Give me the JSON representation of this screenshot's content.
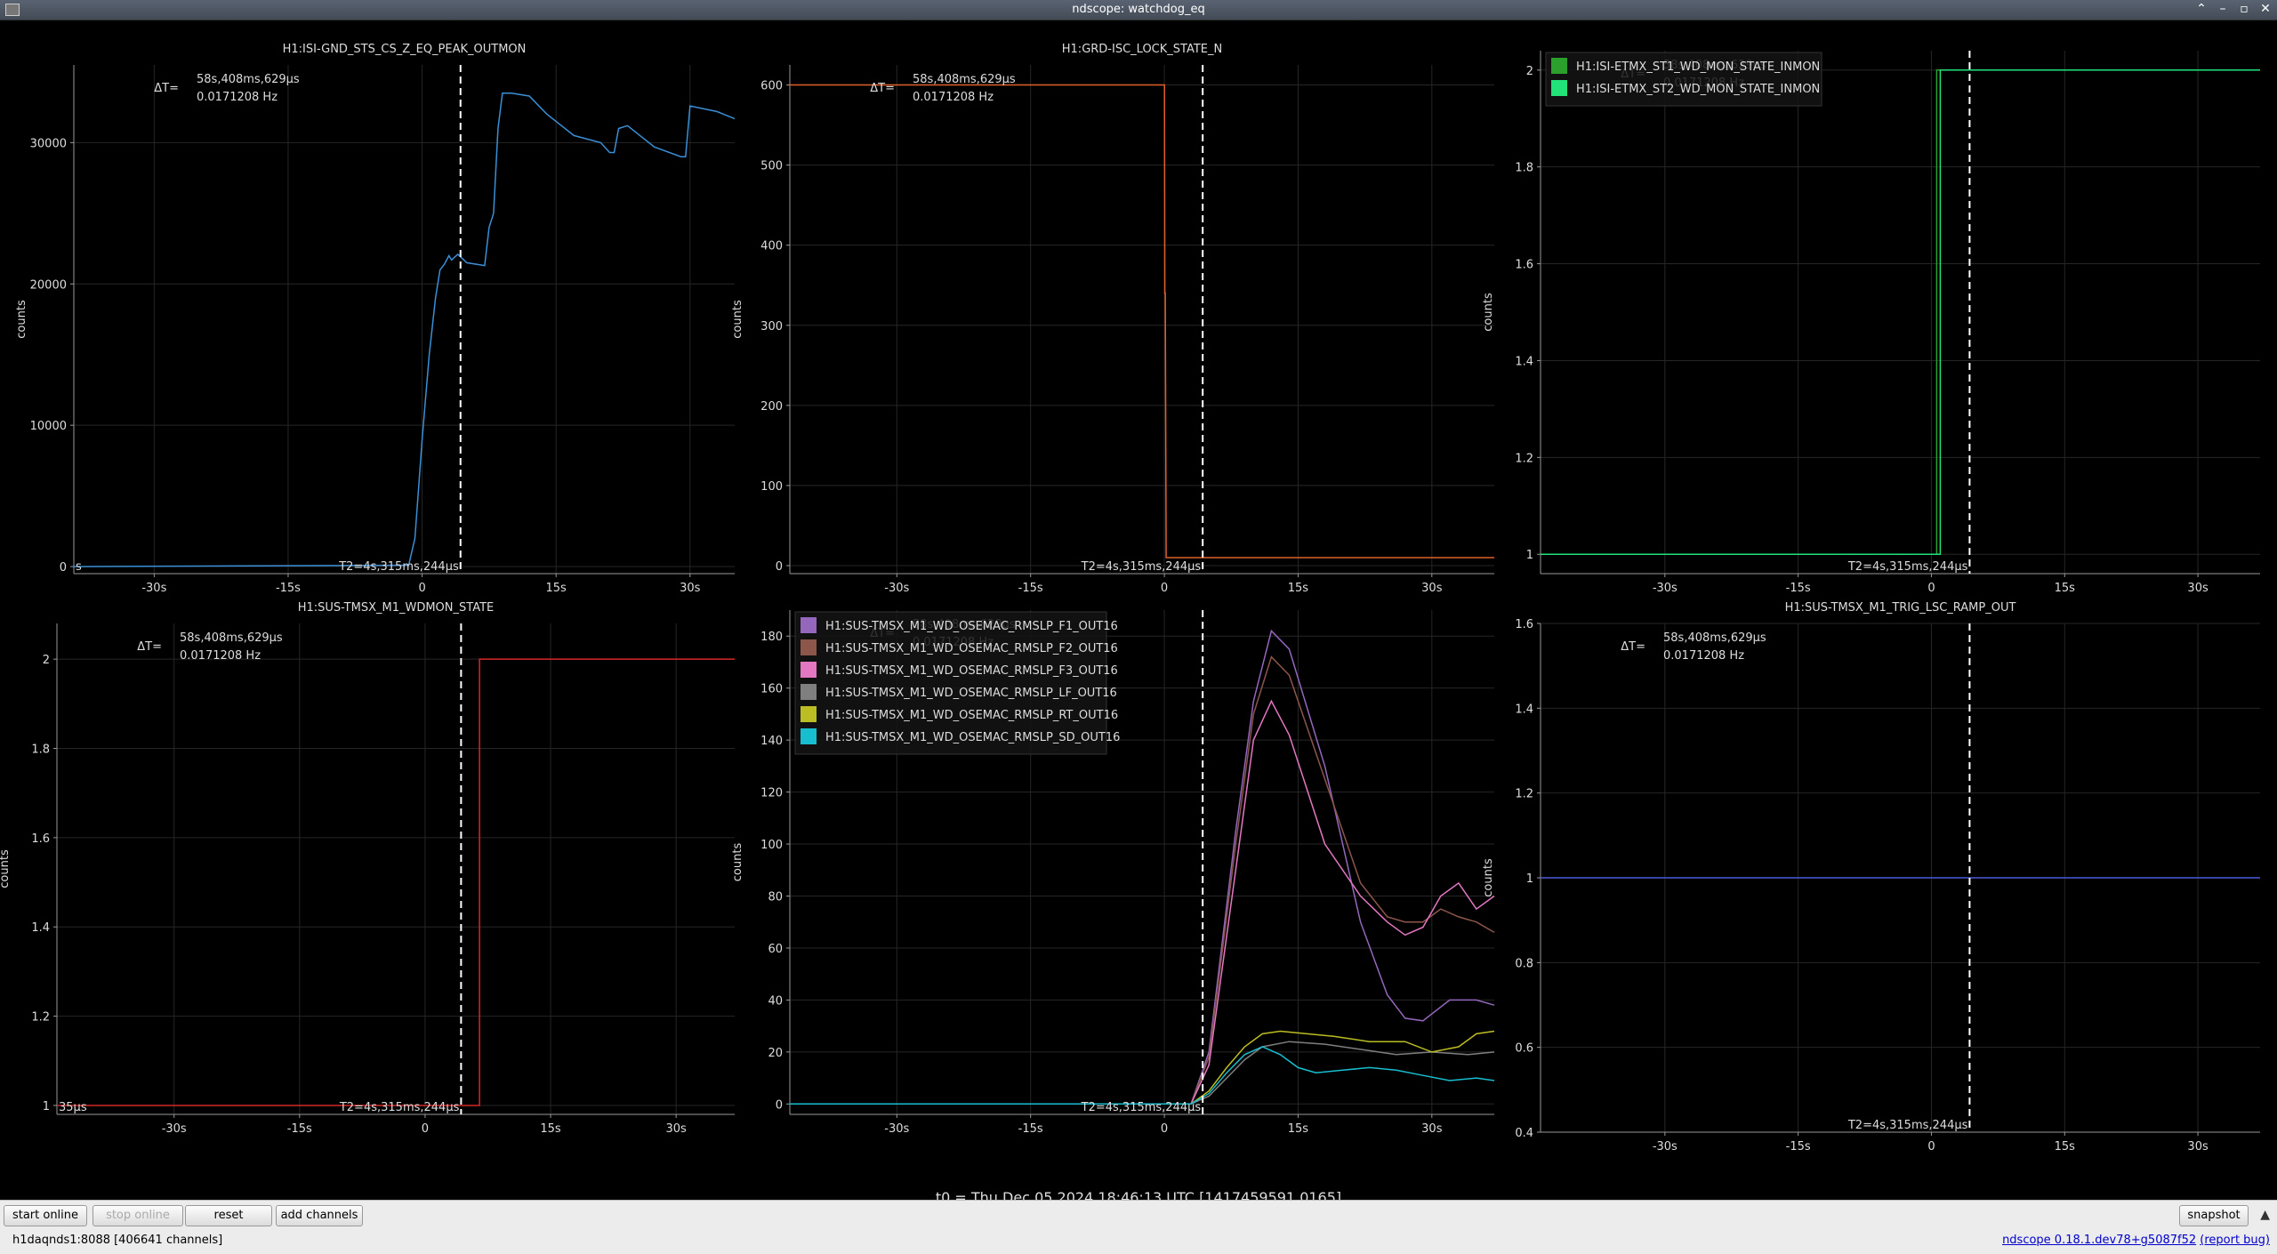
{
  "window": {
    "title": "ndscope: watchdog_eq",
    "controls": [
      "⌃",
      "–",
      "▫",
      "✕"
    ]
  },
  "cursors": {
    "delta_t": "ΔT=",
    "delta_t_value": "58s,408ms,629μs",
    "delta_t_freq": "0.0171208 Hz",
    "t2_label": "T2=4s,315ms,244μs"
  },
  "plots": [
    {
      "title": "H1:ISI-GND_STS_CS_Z_EQ_PEAK_OUTMON",
      "ylabel": "counts",
      "yticks": [
        "0",
        "10000",
        "20000",
        "30000"
      ],
      "xticks": [
        "-30s",
        "-15s",
        "0",
        "15s",
        "30s"
      ],
      "t1_label_fragment": "s",
      "series": [
        {
          "name": "H1:ISI-GND_STS_CS_Z_EQ_PEAK_OUTMON",
          "color": "#3a8fd6"
        }
      ]
    },
    {
      "title": "H1:GRD-ISC_LOCK_STATE_N",
      "ylabel": "counts",
      "yticks": [
        "0",
        "100",
        "200",
        "300",
        "400",
        "500",
        "600"
      ],
      "xticks": [
        "-30s",
        "-15s",
        "0",
        "15s",
        "30s"
      ],
      "series": [
        {
          "name": "H1:GRD-ISC_LOCK_STATE_N",
          "color": "#e0602c"
        }
      ]
    },
    {
      "title": "",
      "ylabel": "counts",
      "yticks": [
        "1",
        "1.2",
        "1.4",
        "1.6",
        "1.8",
        "2"
      ],
      "xticks": [
        "-30s",
        "-15s",
        "0",
        "15s",
        "30s"
      ],
      "legend": [
        {
          "name": "H1:ISI-ETMX_ST1_WD_MON_STATE_INMON",
          "color": "#2ca02c"
        },
        {
          "name": "H1:ISI-ETMX_ST2_WD_MON_STATE_INMON",
          "color": "#22e37a"
        }
      ]
    },
    {
      "title": "H1:SUS-TMSX_M1_WDMON_STATE",
      "ylabel": "counts",
      "yticks": [
        "1",
        "1.2",
        "1.4",
        "1.6",
        "1.8",
        "2"
      ],
      "xticks": [
        "-30s",
        "-15s",
        "0",
        "15s",
        "30s"
      ],
      "t1_label_fragment": "35μs",
      "series": [
        {
          "name": "H1:SUS-TMSX_M1_WDMON_STATE",
          "color": "#d62728"
        }
      ]
    },
    {
      "title": "",
      "ylabel": "counts",
      "yticks": [
        "0",
        "20",
        "40",
        "60",
        "80",
        "100",
        "120",
        "140",
        "160",
        "180"
      ],
      "xticks": [
        "-30s",
        "-15s",
        "0",
        "15s",
        "30s"
      ],
      "legend": [
        {
          "name": "H1:SUS-TMSX_M1_WD_OSEMAC_RMSLP_F1_OUT16",
          "color": "#9467bd"
        },
        {
          "name": "H1:SUS-TMSX_M1_WD_OSEMAC_RMSLP_F2_OUT16",
          "color": "#8c564b"
        },
        {
          "name": "H1:SUS-TMSX_M1_WD_OSEMAC_RMSLP_F3_OUT16",
          "color": "#e377c2"
        },
        {
          "name": "H1:SUS-TMSX_M1_WD_OSEMAC_RMSLP_LF_OUT16",
          "color": "#7f7f7f"
        },
        {
          "name": "H1:SUS-TMSX_M1_WD_OSEMAC_RMSLP_RT_OUT16",
          "color": "#bcbd22"
        },
        {
          "name": "H1:SUS-TMSX_M1_WD_OSEMAC_RMSLP_SD_OUT16",
          "color": "#17becf"
        }
      ]
    },
    {
      "title": "H1:SUS-TMSX_M1_TRIG_LSC_RAMP_OUT",
      "ylabel": "counts",
      "yticks": [
        "0.4",
        "0.6",
        "0.8",
        "1",
        "1.2",
        "1.4",
        "1.6"
      ],
      "xticks": [
        "-30s",
        "-15s",
        "0",
        "15s",
        "30s"
      ],
      "series": [
        {
          "name": "H1:SUS-TMSX_M1_TRIG_LSC_RAMP_OUT",
          "color": "#4a5ad6"
        }
      ]
    }
  ],
  "chart_data": [
    {
      "type": "line",
      "title": "H1:ISI-GND_STS_CS_Z_EQ_PEAK_OUTMON",
      "ylabel": "counts",
      "xlim": [
        -39,
        35
      ],
      "ylim": [
        -500,
        35500
      ],
      "series": [
        {
          "name": "H1:ISI-GND_STS_CS_Z_EQ_PEAK_OUTMON",
          "x": [
            -39,
            -1.5,
            -0.8,
            0,
            0.8,
            1.5,
            2,
            2.5,
            3,
            3.3,
            4,
            5,
            7,
            7.5,
            8,
            8.5,
            9,
            10,
            12,
            14,
            17,
            20,
            21,
            21.5,
            22,
            23,
            26,
            29,
            29.5,
            30,
            33,
            35
          ],
          "y": [
            0,
            100,
            2000,
            9000,
            15000,
            19000,
            21000,
            21400,
            22000,
            21700,
            22100,
            21500,
            21300,
            24000,
            25000,
            31000,
            33500,
            33500,
            33300,
            32000,
            30500,
            30000,
            29300,
            29300,
            31000,
            31200,
            29700,
            29000,
            29000,
            32600,
            32200,
            31700
          ]
        }
      ]
    },
    {
      "type": "line",
      "title": "H1:GRD-ISC_LOCK_STATE_N",
      "ylabel": "counts",
      "xlim": [
        -42,
        37
      ],
      "ylim": [
        -10,
        625
      ],
      "series": [
        {
          "name": "H1:GRD-ISC_LOCK_STATE_N",
          "x": [
            -42,
            0,
            0.01,
            0.05,
            0.1,
            0.2,
            0.3,
            37
          ],
          "y": [
            600,
            600,
            600,
            340,
            340,
            10,
            10,
            10
          ]
        }
      ]
    },
    {
      "type": "line",
      "title": "",
      "ylabel": "counts",
      "xlim": [
        -44,
        37
      ],
      "ylim": [
        0.96,
        2.04
      ],
      "series": [
        {
          "name": "H1:ISI-ETMX_ST1_WD_MON_STATE_INMON",
          "x": [
            -44,
            0.6,
            0.6,
            37
          ],
          "y": [
            1,
            1,
            2,
            2
          ]
        },
        {
          "name": "H1:ISI-ETMX_ST2_WD_MON_STATE_INMON",
          "x": [
            -44,
            1.0,
            1.0,
            37
          ],
          "y": [
            1,
            1,
            2,
            2
          ]
        }
      ]
    },
    {
      "type": "line",
      "title": "H1:SUS-TMSX_M1_WDMON_STATE",
      "ylabel": "counts",
      "xlim": [
        -44,
        37
      ],
      "ylim": [
        0.98,
        2.08
      ],
      "series": [
        {
          "name": "H1:SUS-TMSX_M1_WDMON_STATE",
          "x": [
            -44,
            6.5,
            6.5,
            37
          ],
          "y": [
            1,
            1,
            2,
            2
          ]
        }
      ]
    },
    {
      "type": "line",
      "title": "",
      "ylabel": "counts",
      "xlim": [
        -42,
        37
      ],
      "ylim": [
        -4,
        190
      ],
      "series": [
        {
          "name": "H1:SUS-TMSX_M1_WD_OSEMAC_RMSLP_F1_OUT16",
          "x": [
            -42,
            3,
            5,
            8,
            10,
            12,
            14,
            18,
            22,
            25,
            27,
            29,
            32,
            35,
            37
          ],
          "y": [
            0,
            0,
            20,
            105,
            155,
            182,
            175,
            130,
            70,
            42,
            33,
            32,
            40,
            40,
            38
          ]
        },
        {
          "name": "H1:SUS-TMSX_M1_WD_OSEMAC_RMSLP_F2_OUT16",
          "x": [
            -42,
            3,
            5,
            8,
            10,
            12,
            14,
            18,
            22,
            25,
            27,
            29,
            31,
            33,
            35,
            37
          ],
          "y": [
            0,
            0,
            18,
            100,
            150,
            172,
            165,
            125,
            85,
            72,
            70,
            70,
            75,
            72,
            70,
            66
          ]
        },
        {
          "name": "H1:SUS-TMSX_M1_WD_OSEMAC_RMSLP_F3_OUT16",
          "x": [
            -42,
            3,
            5,
            8,
            10,
            12,
            14,
            18,
            22,
            25,
            27,
            29,
            31,
            33,
            35,
            37
          ],
          "y": [
            0,
            0,
            15,
            90,
            140,
            155,
            142,
            100,
            80,
            70,
            65,
            68,
            80,
            85,
            75,
            80
          ]
        },
        {
          "name": "H1:SUS-TMSX_M1_WD_OSEMAC_RMSLP_LF_OUT16",
          "x": [
            -42,
            3,
            5,
            7,
            9,
            11,
            14,
            18,
            22,
            26,
            30,
            34,
            37
          ],
          "y": [
            0,
            0,
            3,
            10,
            17,
            22,
            24,
            23,
            21,
            19,
            20,
            19,
            20
          ]
        },
        {
          "name": "H1:SUS-TMSX_M1_WD_OSEMAC_RMSLP_RT_OUT16",
          "x": [
            -42,
            3,
            5,
            7,
            9,
            11,
            13,
            16,
            19,
            23,
            27,
            30,
            33,
            35,
            37
          ],
          "y": [
            0,
            0,
            5,
            14,
            22,
            27,
            28,
            27,
            26,
            24,
            24,
            20,
            22,
            27,
            28
          ]
        },
        {
          "name": "H1:SUS-TMSX_M1_WD_OSEMAC_RMSLP_SD_OUT16",
          "x": [
            -42,
            3,
            5,
            7,
            9,
            11,
            13,
            15,
            17,
            20,
            23,
            26,
            29,
            32,
            35,
            37
          ],
          "y": [
            0,
            0,
            4,
            12,
            19,
            22,
            19,
            14,
            12,
            13,
            14,
            13,
            11,
            9,
            10,
            9
          ]
        }
      ]
    },
    {
      "type": "line",
      "title": "H1:SUS-TMSX_M1_TRIG_LSC_RAMP_OUT",
      "ylabel": "counts",
      "xlim": [
        -44,
        37
      ],
      "ylim": [
        0.4,
        1.6
      ],
      "series": [
        {
          "name": "H1:SUS-TMSX_M1_TRIG_LSC_RAMP_OUT",
          "x": [
            -44,
            37
          ],
          "y": [
            1,
            1
          ]
        }
      ]
    }
  ],
  "t0_label": "t0 = Thu Dec 05 2024 18:46:13 UTC [1417459591.0165]",
  "toolbar": {
    "start_online": "start online",
    "stop_online": "stop online",
    "reset": "reset",
    "add_channels": "add channels",
    "snapshot": "snapshot"
  },
  "status": {
    "server": "h1daqnds1:8088  [406641 channels]",
    "version": "ndscope 0.18.1.dev78+g5087f52",
    "report_bug": "(report bug)"
  }
}
